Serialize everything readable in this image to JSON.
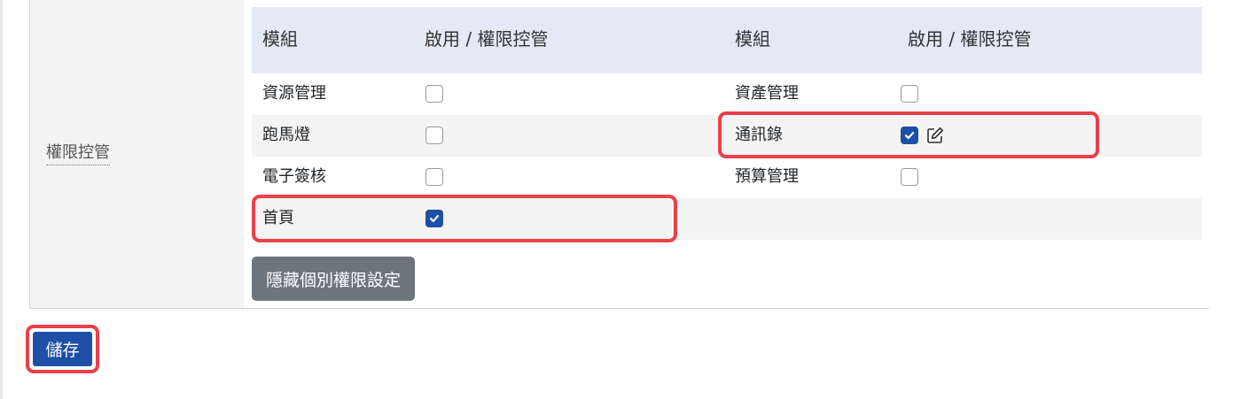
{
  "field": {
    "label": "權限控管"
  },
  "table": {
    "headers": [
      "模組",
      "啟用 / 權限控管",
      "模組",
      "啟用 / 權限控管"
    ],
    "rows": [
      {
        "left": {
          "module": "資源管理",
          "enabled": false
        },
        "right": {
          "module": "資產管理",
          "enabled": false
        }
      },
      {
        "left": {
          "module": "跑馬燈",
          "enabled": false
        },
        "right": {
          "module": "通訊錄",
          "enabled": true,
          "edit_icon": "edit-icon"
        }
      },
      {
        "left": {
          "module": "電子簽核",
          "enabled": false
        },
        "right": {
          "module": "預算管理",
          "enabled": false
        }
      },
      {
        "left": {
          "module": "首頁",
          "enabled": true
        }
      }
    ]
  },
  "buttons": {
    "hide_individual": "隱藏個別權限設定",
    "save": "儲存"
  },
  "colors": {
    "primary": "#1e4fa6",
    "secondary_button": "#6c757d",
    "header_bg": "#e3e9f5",
    "highlight": "#e8414b"
  }
}
